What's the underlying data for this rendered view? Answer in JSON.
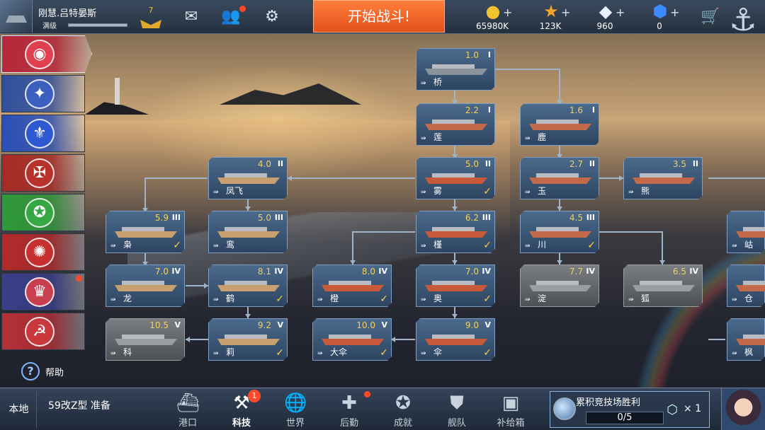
{
  "player": {
    "name": "刚慧.吕特晏斯",
    "level_label": "满级",
    "exp_fraction": 1.0,
    "rank": "7"
  },
  "top_icons": {
    "mail": "mail-icon",
    "friends": "friends-icon",
    "settings": "gear-icon"
  },
  "start_battle": "开始战斗!",
  "resources": [
    {
      "name": "gold",
      "icon": "gold-coin-icon",
      "value": "65980K",
      "color": "#f2c12e"
    },
    {
      "name": "star",
      "icon": "star-icon",
      "value": "123K",
      "color": "#f4a52a"
    },
    {
      "name": "diamond",
      "icon": "diamond-icon",
      "value": "960",
      "color": "#e8f0ff"
    },
    {
      "name": "crystal",
      "icon": "blue-crystal-icon",
      "value": "0",
      "color": "#3c8cff"
    }
  ],
  "nations": [
    {
      "id": "japan",
      "color": "#b8263a",
      "emblem_color": "#e04050",
      "active": true
    },
    {
      "id": "usa",
      "color": "#2f4f9e",
      "emblem_color": "#3b60c0",
      "active": false
    },
    {
      "id": "france",
      "color": "#2a4fb8",
      "emblem_color": "#2f59d0",
      "active": false
    },
    {
      "id": "germany",
      "color": "#a82a26",
      "emblem_color": "#b8322c",
      "active": false
    },
    {
      "id": "italy",
      "color": "#2e9a3a",
      "emblem_color": "#35a844",
      "active": false
    },
    {
      "id": "china",
      "color": "#b52a2a",
      "emblem_color": "#c83030",
      "active": false
    },
    {
      "id": "uk",
      "color": "#3a3f8a",
      "emblem_color": "#c84050",
      "active": false,
      "notice": true
    },
    {
      "id": "ussr",
      "color": "#b83036",
      "emblem_color": "#c8383c",
      "active": false
    }
  ],
  "help": "帮助",
  "tech_tree": [
    {
      "id": "n1",
      "name": "桥",
      "level": "1.0",
      "tier": "I",
      "class": "DD",
      "type": "destroyer",
      "grey": false,
      "check": false
    },
    {
      "id": "n2",
      "name": "莲",
      "level": "2.2",
      "tier": "I",
      "class": "DD",
      "type": "cruiser",
      "grey": false,
      "check": false
    },
    {
      "id": "n3",
      "name": "鹿",
      "level": "1.6",
      "tier": "I",
      "class": "DD",
      "type": "cruiser",
      "grey": false,
      "check": false
    },
    {
      "id": "n4",
      "name": "凤飞",
      "level": "4.0",
      "tier": "II",
      "class": "CV",
      "type": "carrier",
      "grey": false,
      "check": false
    },
    {
      "id": "n5",
      "name": "雾",
      "level": "5.0",
      "tier": "II",
      "class": "BB",
      "type": "battleship",
      "grey": false,
      "check": true
    },
    {
      "id": "n6",
      "name": "玉",
      "level": "2.7",
      "tier": "II",
      "class": "CA",
      "type": "cruiser",
      "grey": false,
      "check": false
    },
    {
      "id": "n7",
      "name": "熊",
      "level": "3.5",
      "tier": "II",
      "class": "CA",
      "type": "cruiser",
      "grey": false,
      "check": false
    },
    {
      "id": "n8",
      "name": "枭",
      "level": "5.9",
      "tier": "III",
      "class": "CV",
      "type": "carrier",
      "grey": false,
      "check": true
    },
    {
      "id": "n9",
      "name": "鸾",
      "level": "5.0",
      "tier": "III",
      "class": "CV",
      "type": "carrier",
      "grey": false,
      "check": false
    },
    {
      "id": "n10",
      "name": "槿",
      "level": "6.2",
      "tier": "III",
      "class": "BB",
      "type": "battleship",
      "grey": false,
      "check": true
    },
    {
      "id": "n11",
      "name": "川",
      "level": "4.5",
      "tier": "III",
      "class": "CA",
      "type": "cruiser",
      "grey": false,
      "check": true
    },
    {
      "id": "n12",
      "name": "岵",
      "level": "",
      "tier": "",
      "class": "CA",
      "type": "cruiser",
      "grey": false,
      "check": false
    },
    {
      "id": "n13",
      "name": "龙",
      "level": "7.0",
      "tier": "IV",
      "class": "CV",
      "type": "carrier",
      "grey": false,
      "check": false
    },
    {
      "id": "n14",
      "name": "鹤",
      "level": "8.1",
      "tier": "IV",
      "class": "CV",
      "type": "carrier",
      "grey": false,
      "check": true
    },
    {
      "id": "n15",
      "name": "橙",
      "level": "8.0",
      "tier": "IV",
      "class": "BB",
      "type": "battleship",
      "grey": false,
      "check": true
    },
    {
      "id": "n16",
      "name": "奥",
      "level": "7.0",
      "tier": "IV",
      "class": "BB",
      "type": "battleship",
      "grey": false,
      "check": true
    },
    {
      "id": "n17",
      "name": "淀",
      "level": "7.7",
      "tier": "IV",
      "class": "CA",
      "type": "cruiser",
      "grey": true,
      "check": false
    },
    {
      "id": "n18",
      "name": "狐",
      "level": "6.5",
      "tier": "IV",
      "class": "CA",
      "type": "cruiser",
      "grey": true,
      "check": false
    },
    {
      "id": "n19",
      "name": "仓",
      "level": "",
      "tier": "",
      "class": "CA",
      "type": "cruiser",
      "grey": false,
      "check": false
    },
    {
      "id": "n20",
      "name": "科",
      "level": "10.5",
      "tier": "V",
      "class": "CV",
      "type": "carrier",
      "grey": true,
      "check": false
    },
    {
      "id": "n21",
      "name": "莉",
      "level": "9.2",
      "tier": "V",
      "class": "CV",
      "type": "carrier",
      "grey": false,
      "check": true
    },
    {
      "id": "n22",
      "name": "大伞",
      "level": "10.0",
      "tier": "V",
      "class": "BB",
      "type": "battleship",
      "grey": false,
      "check": true
    },
    {
      "id": "n23",
      "name": "伞",
      "level": "9.0",
      "tier": "V",
      "class": "BB",
      "type": "battleship",
      "grey": false,
      "check": true
    },
    {
      "id": "n24",
      "name": "枫",
      "level": "",
      "tier": "",
      "class": "CA",
      "type": "cruiser",
      "grey": false,
      "check": false
    }
  ],
  "bottom": {
    "local": "本地",
    "prep": "59改Z型 准备",
    "nav": [
      {
        "id": "port",
        "label": "港口",
        "icon": "port-icon",
        "active": false,
        "badge": "",
        "dot": false
      },
      {
        "id": "tech",
        "label": "科技",
        "icon": "tech-icon",
        "active": true,
        "badge": "1",
        "dot": false
      },
      {
        "id": "world",
        "label": "世界",
        "icon": "globe-icon",
        "active": false,
        "badge": "",
        "dot": false
      },
      {
        "id": "logistics",
        "label": "后勤",
        "icon": "logistics-icon",
        "active": false,
        "badge": "",
        "dot": true
      },
      {
        "id": "achievement",
        "label": "成就",
        "icon": "achievement-icon",
        "active": false,
        "badge": "",
        "dot": false
      },
      {
        "id": "fleet",
        "label": "舰队",
        "icon": "fleet-icon",
        "active": false,
        "badge": "",
        "dot": false
      },
      {
        "id": "supply",
        "label": "补给箱",
        "icon": "supply-box-icon",
        "active": false,
        "badge": "",
        "dot": false
      }
    ],
    "arena": {
      "title": "累积竞技场胜利",
      "progress": "0/5",
      "reward": "× 1"
    }
  }
}
